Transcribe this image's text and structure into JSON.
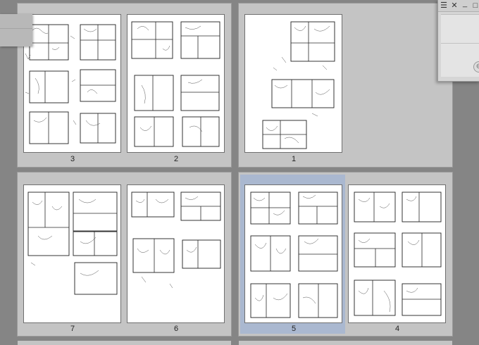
{
  "pages": {
    "p3": "3",
    "p2": "2",
    "p1": "1",
    "p7": "7",
    "p6": "6",
    "p5": "5",
    "p4": "4"
  },
  "palette": {
    "menu_icon": "☰",
    "close_icon": "✕",
    "minimize_icon": "_",
    "restore_icon": "□"
  },
  "colors": {
    "workspace": "#858585",
    "spread": "#c4c4c4",
    "selected": "#aab8d0"
  }
}
